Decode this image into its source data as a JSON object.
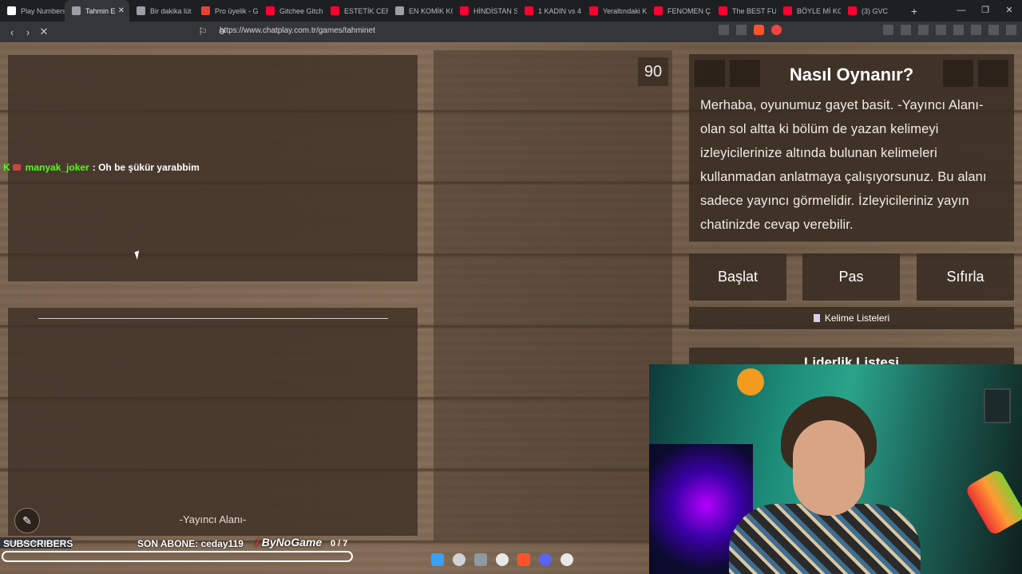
{
  "browser": {
    "tabs": [
      {
        "label": "Play Numbers",
        "color": "#ffffff"
      },
      {
        "label": "Tahmin E",
        "color": "#9aa0a6",
        "active": true
      },
      {
        "label": "Bir dakika lüt",
        "color": "#9aa0a6"
      },
      {
        "label": "Pro üyelik - G",
        "color": "#e94235"
      },
      {
        "label": "Gitchee Gitch",
        "color": "#ff0033"
      },
      {
        "label": "ESTETİK CERR",
        "color": "#ff0033"
      },
      {
        "label": "EN KOMİK KO",
        "color": "#9aa0a6"
      },
      {
        "label": "HİNDİSTAN S",
        "color": "#ff0033"
      },
      {
        "label": "1 KADIN vs 4",
        "color": "#ff0033"
      },
      {
        "label": "Yeraltındaki K",
        "color": "#ff0033"
      },
      {
        "label": "FENOMEN Ç",
        "color": "#ff0033"
      },
      {
        "label": "The BEST FUR",
        "color": "#ff0033"
      },
      {
        "label": "BÖYLE Mİ KO",
        "color": "#ff0033"
      },
      {
        "label": "(3) GVC",
        "color": "#ff0033"
      }
    ],
    "url": "https://www.chatplay.com.tr/games/tahminet"
  },
  "chat": {
    "username": "manyak_joker",
    "message": ": Oh be şükür yarabbim"
  },
  "streamer_area_label": "-Yayıncı Alanı-",
  "timer": "90",
  "howto": {
    "title": "Nasıl Oynanır?",
    "text": "Merhaba, oyunumuz gayet basit. -Yayıncı Alanı- olan sol altta ki bölüm de yazan kelimeyi izleyicilerinize altında bulunan kelimeleri kullanmadan anlatmaya çalışıyorsunuz. Bu alanı sadece yayıncı görmelidir. İzleyicileriniz yayın chatinizde cevap verebilir."
  },
  "buttons": {
    "start": "Başlat",
    "pass": "Pas",
    "reset": "Sıfırla",
    "word_lists": "Kelime Listeleri",
    "leaderboard": "Liderlik Listesi"
  },
  "overlay": {
    "status_url": "om.tr/games/tahminet",
    "subscribers": "SUBSCRIBERS",
    "son_abone": "SON ABONE: ceday119",
    "brand": "ByNoGame",
    "progress": "0 / 7"
  }
}
